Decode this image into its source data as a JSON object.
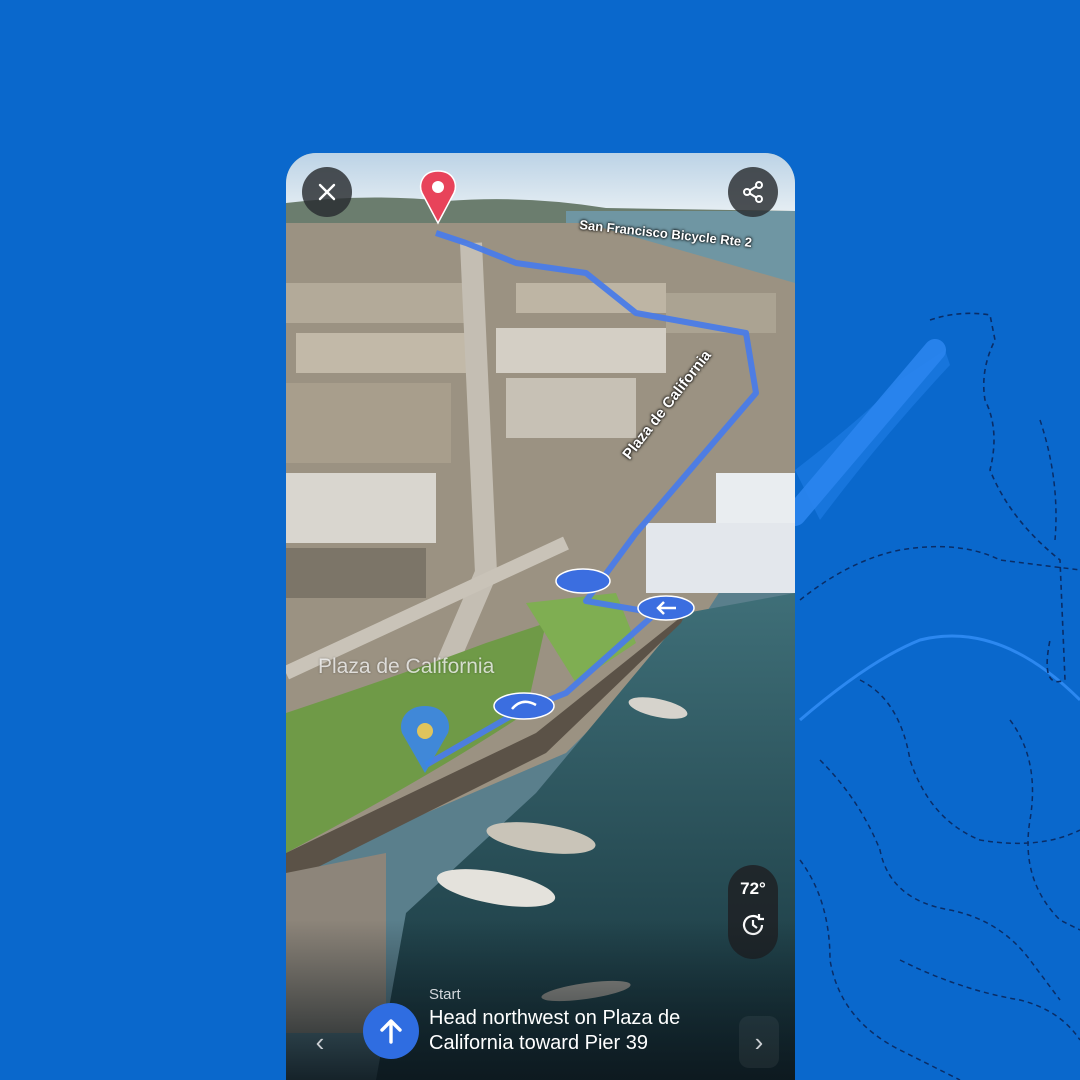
{
  "map": {
    "bike_route_label": "San Francisco Bicycle Rte 2",
    "road_label": "Plaza de California",
    "place_label": "Plaza de California"
  },
  "weather": {
    "temperature": "72°",
    "time_icon": "history-clock-icon"
  },
  "controls": {
    "close_icon": "close-icon",
    "share_icon": "share-icon"
  },
  "navigation": {
    "step_label": "Start",
    "instruction": "Head northwest on Plaza de California toward Pier 39",
    "direction_icon": "arrow-up-icon",
    "prev_icon": "chevron-left-icon",
    "next_icon": "chevron-right-icon"
  },
  "colors": {
    "background": "#0a68cc",
    "route": "#4a7ce8",
    "destination_pin": "#e8435a",
    "origin_pin": "#3b86e8",
    "nav_button": "#2f6de1"
  }
}
